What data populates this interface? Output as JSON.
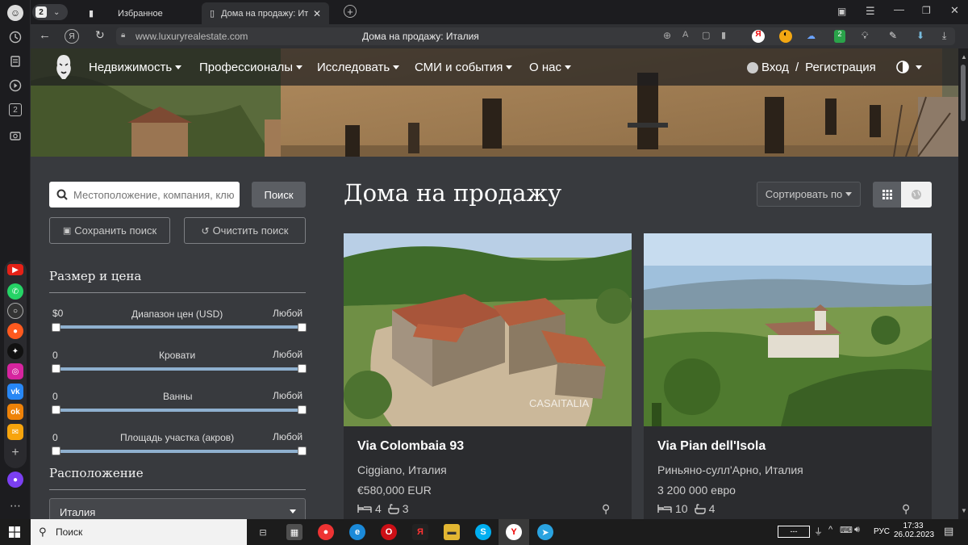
{
  "browser": {
    "tab_count": "2",
    "tabs": [
      {
        "label": "Избранное"
      },
      {
        "label": "Дома на продажу: Ита"
      }
    ],
    "url": "www.luxuryrealestate.com",
    "page_title": "Дома на продажу: Италия"
  },
  "site": {
    "nav": {
      "items": [
        "Недвижимость",
        "Профессионалы",
        "Исследовать",
        "СМИ и события",
        "О нас"
      ],
      "login": "Вход",
      "separator": "/",
      "register": "Регистрация"
    }
  },
  "search": {
    "placeholder": "Местоположение, компания, клю",
    "button": "Поиск",
    "save": "Сохранить поиск",
    "clear": "Очистить поиск"
  },
  "filters": {
    "size_price_title": "Размер и цена",
    "ranges": [
      {
        "min": "$0",
        "label": "Диапазон цен (USD)",
        "max": "Любой"
      },
      {
        "min": "0",
        "label": "Кровати",
        "max": "Любой"
      },
      {
        "min": "0",
        "label": "Ванны",
        "max": "Любой"
      },
      {
        "min": "0",
        "label": "Площадь участка (акров)",
        "max": "Любой"
      }
    ],
    "location_title": "Расположение",
    "location_value": "Италия"
  },
  "main": {
    "heading": "Дома на продажу",
    "sort": "Сортировать по"
  },
  "listings": [
    {
      "title": "Via Colombaia 93",
      "location": "Ciggiano, Италия",
      "price": "€580,000 EUR",
      "beds": "4",
      "baths": "3",
      "watermark": "CASAITALIA"
    },
    {
      "title": "Via Pian dell'Isola",
      "location": "Риньяно-сулл'Арно, Италия",
      "price": "3 200 000 евро",
      "beds": "10",
      "baths": "4"
    }
  ],
  "taskbar": {
    "search": "Поиск",
    "lang": "РУС",
    "time": "17:33",
    "date": "26.02.2023"
  },
  "colors": {
    "page_bg": "#383a3e",
    "slider_track": "#8fb0cf",
    "card_bg": "#2b2c2f"
  }
}
